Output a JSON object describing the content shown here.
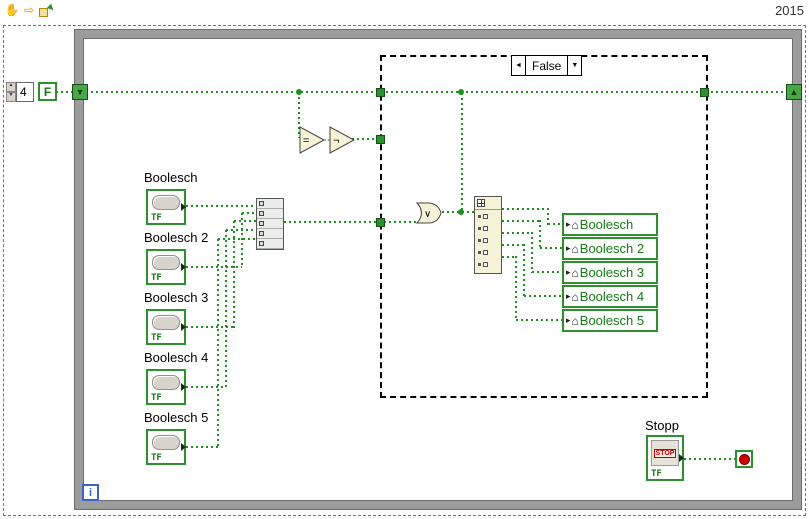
{
  "window": {
    "year": "2015"
  },
  "icons": {
    "hand": "✋",
    "nav_arrow": "⇨",
    "step_arrow": "▶",
    "sr_down": "▼",
    "sr_up": "▲",
    "house": "⌂",
    "local_arrow": "▸",
    "sel_prev": "◄",
    "sel_menu": "▼",
    "spin_up": "▲",
    "spin_down": "▼"
  },
  "constants": {
    "numeric_value": "4",
    "boolean_false": "F"
  },
  "case_structure": {
    "selector_value": "False"
  },
  "boolean_controls": [
    {
      "label": "Boolesch",
      "terminal": "TF"
    },
    {
      "label": "Boolesch 2",
      "terminal": "TF"
    },
    {
      "label": "Boolesch 3",
      "terminal": "TF"
    },
    {
      "label": "Boolesch 4",
      "terminal": "TF"
    },
    {
      "label": "Boolesch 5",
      "terminal": "TF"
    }
  ],
  "local_variables": [
    {
      "label": "Boolesch"
    },
    {
      "label": "Boolesch 2"
    },
    {
      "label": "Boolesch 3"
    },
    {
      "label": "Boolesch 4"
    },
    {
      "label": "Boolesch 5"
    }
  ],
  "function_nodes": {
    "equal": "=",
    "not": "¬",
    "or": "∨"
  },
  "stop_control": {
    "label": "Stopp",
    "button_text": "STOP",
    "terminal": "TF"
  },
  "while_loop": {
    "iteration": "i"
  },
  "wire_color": "#1f8f1f"
}
